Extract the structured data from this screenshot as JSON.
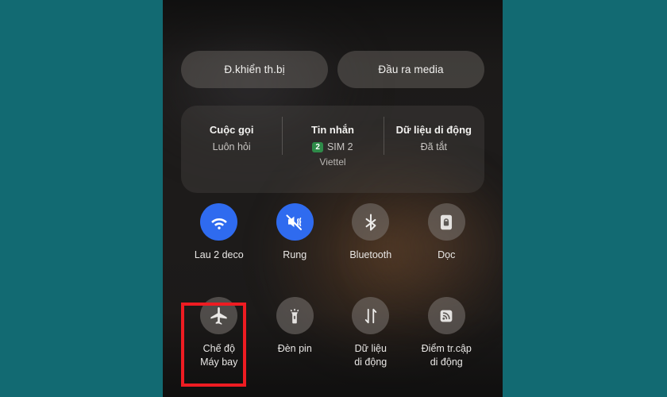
{
  "theme": {
    "page_background": "#126a72",
    "panel_background": "#1d1b1a",
    "active_toggle_color": "#2f6bef",
    "inactive_toggle_color": "#807b76",
    "highlight_color": "#ee1c22",
    "sim_badge_color": "#2e8b49"
  },
  "quick_settings": {
    "pills": [
      {
        "label": "Đ.khiển th.bị",
        "icon": "device-control-icon"
      },
      {
        "label": "Đầu ra media",
        "icon": "media-output-icon"
      }
    ],
    "info_card": {
      "columns": [
        {
          "title": "Cuộc gọi",
          "value": "Luôn hỏi",
          "badge": "",
          "extra": ""
        },
        {
          "title": "Tin nhắn",
          "value": "SIM 2",
          "badge": "2",
          "extra": "Viettel"
        },
        {
          "title": "Dữ liệu di động",
          "value": "Đã tắt",
          "badge": "",
          "extra": ""
        }
      ]
    },
    "tiles": [
      {
        "label": "Lau 2 deco",
        "icon": "wifi-icon",
        "state": "on"
      },
      {
        "label": "Rung",
        "icon": "vibrate-mute-icon",
        "state": "on"
      },
      {
        "label": "Bluetooth",
        "icon": "bluetooth-icon",
        "state": "off"
      },
      {
        "label": "Dọc",
        "icon": "rotation-lock-icon",
        "state": "off"
      },
      {
        "label": "Chế độ\nMáy bay",
        "icon": "airplane-icon",
        "state": "off"
      },
      {
        "label": "Đèn pin",
        "icon": "flashlight-icon",
        "state": "off"
      },
      {
        "label": "Dữ liệu\ndi động",
        "icon": "mobile-data-icon",
        "state": "off"
      },
      {
        "label": "Điểm tr.cập\ndi động",
        "icon": "hotspot-icon",
        "state": "off"
      }
    ]
  },
  "annotation": {
    "target_label": "Chế độ Máy bay",
    "shape": "rectangle",
    "color": "#ee1c22"
  }
}
